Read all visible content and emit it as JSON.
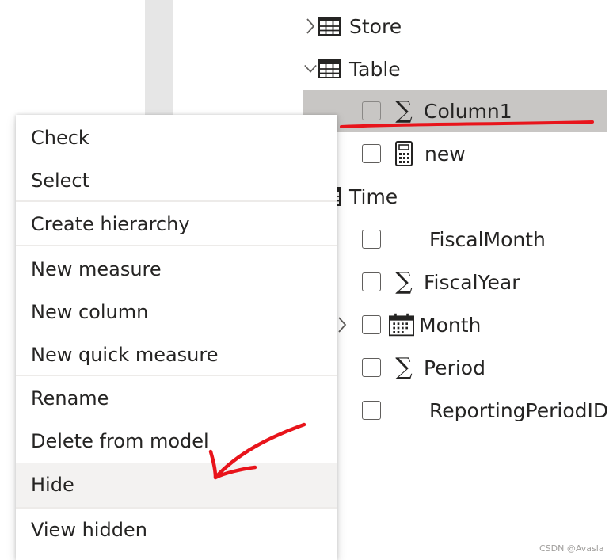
{
  "fields": {
    "tables": [
      {
        "name": "Store",
        "expanded": false
      },
      {
        "name": "Table",
        "expanded": true
      },
      {
        "name": "Time",
        "expanded": true
      }
    ],
    "table_fields": [
      {
        "name": "Column1",
        "icon": "sigma-icon",
        "selected": true
      },
      {
        "name": "new",
        "icon": "calculator-icon"
      }
    ],
    "time_fields": [
      {
        "name": "FiscalMonth",
        "icon": ""
      },
      {
        "name": "FiscalYear",
        "icon": "sigma-icon"
      },
      {
        "name": "Month",
        "icon": "calendar-icon"
      },
      {
        "name": "Period",
        "icon": "sigma-icon"
      },
      {
        "name": "ReportingPeriodID",
        "icon": ""
      }
    ]
  },
  "menu": {
    "items": [
      {
        "label": "Check"
      },
      {
        "label": "Select"
      },
      {
        "label": "Create hierarchy"
      },
      {
        "label": "New measure"
      },
      {
        "label": "New column"
      },
      {
        "label": "New quick measure"
      },
      {
        "label": "Rename"
      },
      {
        "label": "Delete from model"
      },
      {
        "label": "Hide",
        "highlighted": true
      },
      {
        "label": "View hidden"
      }
    ]
  },
  "watermark": "CSDN @Avasla",
  "colors": {
    "selected_row": "#c8c6c4",
    "annotation": "#e8141b",
    "menu_hover": "#f3f2f1"
  }
}
